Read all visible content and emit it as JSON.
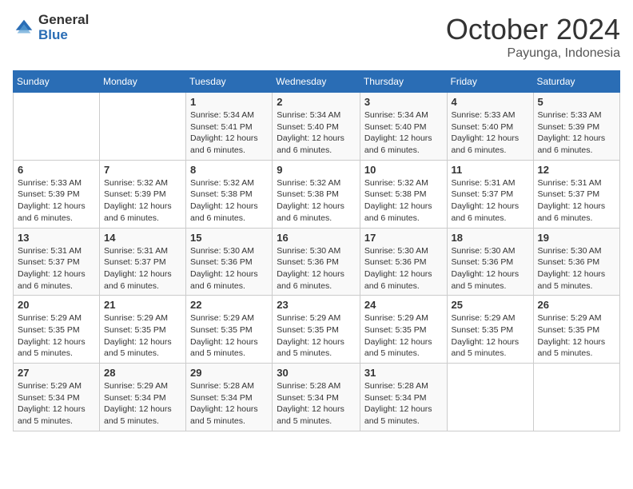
{
  "logo": {
    "general": "General",
    "blue": "Blue"
  },
  "header": {
    "month": "October 2024",
    "location": "Payunga, Indonesia"
  },
  "weekdays": [
    "Sunday",
    "Monday",
    "Tuesday",
    "Wednesday",
    "Thursday",
    "Friday",
    "Saturday"
  ],
  "weeks": [
    [
      {
        "day": "",
        "sunrise": "",
        "sunset": "",
        "daylight": ""
      },
      {
        "day": "",
        "sunrise": "",
        "sunset": "",
        "daylight": ""
      },
      {
        "day": "1",
        "sunrise": "Sunrise: 5:34 AM",
        "sunset": "Sunset: 5:41 PM",
        "daylight": "Daylight: 12 hours and 6 minutes."
      },
      {
        "day": "2",
        "sunrise": "Sunrise: 5:34 AM",
        "sunset": "Sunset: 5:40 PM",
        "daylight": "Daylight: 12 hours and 6 minutes."
      },
      {
        "day": "3",
        "sunrise": "Sunrise: 5:34 AM",
        "sunset": "Sunset: 5:40 PM",
        "daylight": "Daylight: 12 hours and 6 minutes."
      },
      {
        "day": "4",
        "sunrise": "Sunrise: 5:33 AM",
        "sunset": "Sunset: 5:40 PM",
        "daylight": "Daylight: 12 hours and 6 minutes."
      },
      {
        "day": "5",
        "sunrise": "Sunrise: 5:33 AM",
        "sunset": "Sunset: 5:39 PM",
        "daylight": "Daylight: 12 hours and 6 minutes."
      }
    ],
    [
      {
        "day": "6",
        "sunrise": "Sunrise: 5:33 AM",
        "sunset": "Sunset: 5:39 PM",
        "daylight": "Daylight: 12 hours and 6 minutes."
      },
      {
        "day": "7",
        "sunrise": "Sunrise: 5:32 AM",
        "sunset": "Sunset: 5:39 PM",
        "daylight": "Daylight: 12 hours and 6 minutes."
      },
      {
        "day": "8",
        "sunrise": "Sunrise: 5:32 AM",
        "sunset": "Sunset: 5:38 PM",
        "daylight": "Daylight: 12 hours and 6 minutes."
      },
      {
        "day": "9",
        "sunrise": "Sunrise: 5:32 AM",
        "sunset": "Sunset: 5:38 PM",
        "daylight": "Daylight: 12 hours and 6 minutes."
      },
      {
        "day": "10",
        "sunrise": "Sunrise: 5:32 AM",
        "sunset": "Sunset: 5:38 PM",
        "daylight": "Daylight: 12 hours and 6 minutes."
      },
      {
        "day": "11",
        "sunrise": "Sunrise: 5:31 AM",
        "sunset": "Sunset: 5:37 PM",
        "daylight": "Daylight: 12 hours and 6 minutes."
      },
      {
        "day": "12",
        "sunrise": "Sunrise: 5:31 AM",
        "sunset": "Sunset: 5:37 PM",
        "daylight": "Daylight: 12 hours and 6 minutes."
      }
    ],
    [
      {
        "day": "13",
        "sunrise": "Sunrise: 5:31 AM",
        "sunset": "Sunset: 5:37 PM",
        "daylight": "Daylight: 12 hours and 6 minutes."
      },
      {
        "day": "14",
        "sunrise": "Sunrise: 5:31 AM",
        "sunset": "Sunset: 5:37 PM",
        "daylight": "Daylight: 12 hours and 6 minutes."
      },
      {
        "day": "15",
        "sunrise": "Sunrise: 5:30 AM",
        "sunset": "Sunset: 5:36 PM",
        "daylight": "Daylight: 12 hours and 6 minutes."
      },
      {
        "day": "16",
        "sunrise": "Sunrise: 5:30 AM",
        "sunset": "Sunset: 5:36 PM",
        "daylight": "Daylight: 12 hours and 6 minutes."
      },
      {
        "day": "17",
        "sunrise": "Sunrise: 5:30 AM",
        "sunset": "Sunset: 5:36 PM",
        "daylight": "Daylight: 12 hours and 6 minutes."
      },
      {
        "day": "18",
        "sunrise": "Sunrise: 5:30 AM",
        "sunset": "Sunset: 5:36 PM",
        "daylight": "Daylight: 12 hours and 5 minutes."
      },
      {
        "day": "19",
        "sunrise": "Sunrise: 5:30 AM",
        "sunset": "Sunset: 5:36 PM",
        "daylight": "Daylight: 12 hours and 5 minutes."
      }
    ],
    [
      {
        "day": "20",
        "sunrise": "Sunrise: 5:29 AM",
        "sunset": "Sunset: 5:35 PM",
        "daylight": "Daylight: 12 hours and 5 minutes."
      },
      {
        "day": "21",
        "sunrise": "Sunrise: 5:29 AM",
        "sunset": "Sunset: 5:35 PM",
        "daylight": "Daylight: 12 hours and 5 minutes."
      },
      {
        "day": "22",
        "sunrise": "Sunrise: 5:29 AM",
        "sunset": "Sunset: 5:35 PM",
        "daylight": "Daylight: 12 hours and 5 minutes."
      },
      {
        "day": "23",
        "sunrise": "Sunrise: 5:29 AM",
        "sunset": "Sunset: 5:35 PM",
        "daylight": "Daylight: 12 hours and 5 minutes."
      },
      {
        "day": "24",
        "sunrise": "Sunrise: 5:29 AM",
        "sunset": "Sunset: 5:35 PM",
        "daylight": "Daylight: 12 hours and 5 minutes."
      },
      {
        "day": "25",
        "sunrise": "Sunrise: 5:29 AM",
        "sunset": "Sunset: 5:35 PM",
        "daylight": "Daylight: 12 hours and 5 minutes."
      },
      {
        "day": "26",
        "sunrise": "Sunrise: 5:29 AM",
        "sunset": "Sunset: 5:35 PM",
        "daylight": "Daylight: 12 hours and 5 minutes."
      }
    ],
    [
      {
        "day": "27",
        "sunrise": "Sunrise: 5:29 AM",
        "sunset": "Sunset: 5:34 PM",
        "daylight": "Daylight: 12 hours and 5 minutes."
      },
      {
        "day": "28",
        "sunrise": "Sunrise: 5:29 AM",
        "sunset": "Sunset: 5:34 PM",
        "daylight": "Daylight: 12 hours and 5 minutes."
      },
      {
        "day": "29",
        "sunrise": "Sunrise: 5:28 AM",
        "sunset": "Sunset: 5:34 PM",
        "daylight": "Daylight: 12 hours and 5 minutes."
      },
      {
        "day": "30",
        "sunrise": "Sunrise: 5:28 AM",
        "sunset": "Sunset: 5:34 PM",
        "daylight": "Daylight: 12 hours and 5 minutes."
      },
      {
        "day": "31",
        "sunrise": "Sunrise: 5:28 AM",
        "sunset": "Sunset: 5:34 PM",
        "daylight": "Daylight: 12 hours and 5 minutes."
      },
      {
        "day": "",
        "sunrise": "",
        "sunset": "",
        "daylight": ""
      },
      {
        "day": "",
        "sunrise": "",
        "sunset": "",
        "daylight": ""
      }
    ]
  ]
}
